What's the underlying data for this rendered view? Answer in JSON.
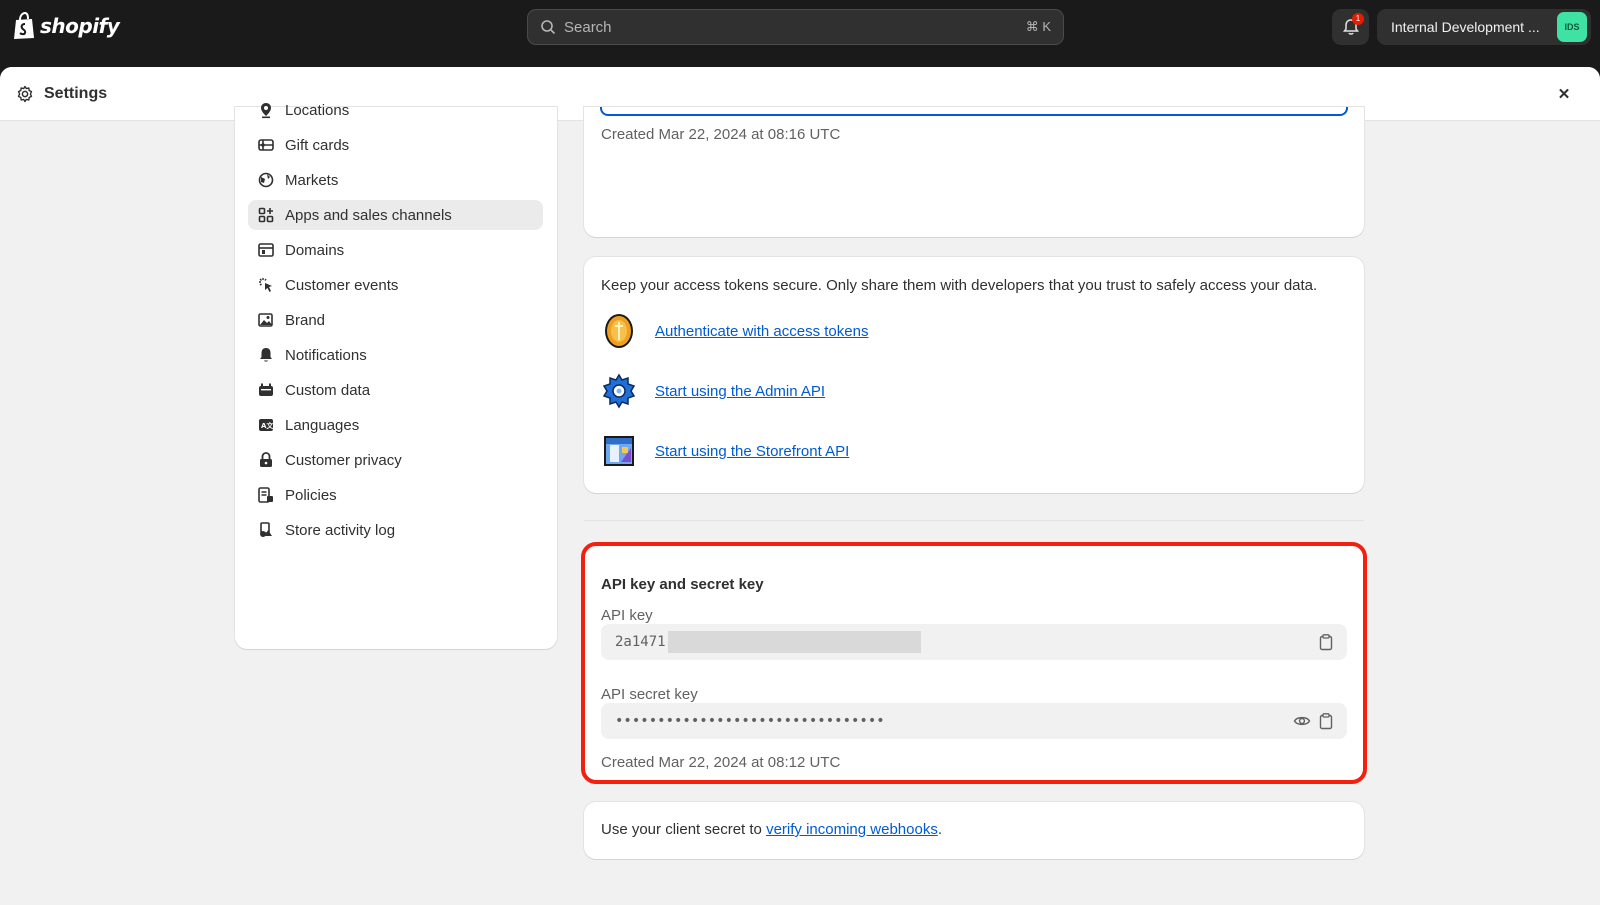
{
  "topbar": {
    "logo_text": "shopify",
    "search_placeholder": "Search",
    "search_shortcut": "⌘ K",
    "notification_count": "1",
    "store_name": "Internal Development ...",
    "avatar_initials": "IDS"
  },
  "modal": {
    "title": "Settings",
    "close_label": "✕"
  },
  "sidebar": {
    "items": [
      {
        "label": "Locations",
        "icon": "location-pin-icon"
      },
      {
        "label": "Gift cards",
        "icon": "gift-card-icon"
      },
      {
        "label": "Markets",
        "icon": "globe-icon"
      },
      {
        "label": "Apps and sales channels",
        "icon": "apps-icon",
        "active": true
      },
      {
        "label": "Domains",
        "icon": "domain-icon"
      },
      {
        "label": "Customer events",
        "icon": "cursor-click-icon"
      },
      {
        "label": "Brand",
        "icon": "brand-image-icon"
      },
      {
        "label": "Notifications",
        "icon": "bell-icon"
      },
      {
        "label": "Custom data",
        "icon": "custom-data-icon"
      },
      {
        "label": "Languages",
        "icon": "language-icon"
      },
      {
        "label": "Customer privacy",
        "icon": "lock-icon"
      },
      {
        "label": "Policies",
        "icon": "policy-list-icon"
      },
      {
        "label": "Store activity log",
        "icon": "activity-log-icon"
      }
    ]
  },
  "content": {
    "token_created": "Created Mar 22, 2024 at 08:16 UTC",
    "tokens_intro": "Keep your access tokens secure. Only share them with developers that you trust to safely access your data.",
    "links": [
      {
        "label": "Authenticate with access tokens",
        "icon": "coin-icon"
      },
      {
        "label": "Start using the Admin API",
        "icon": "gear-pixel-icon"
      },
      {
        "label": "Start using the Storefront API",
        "icon": "storefront-pixel-icon"
      }
    ],
    "api_section": {
      "heading": "API key and secret key",
      "api_key_label": "API key",
      "api_key_value": "2a1471",
      "secret_label": "API secret key",
      "secret_value": "••••••••••••••••••••••••••••••••",
      "created": "Created Mar 22, 2024 at 08:12 UTC",
      "highlight_color": "#f2200c"
    },
    "webhook": {
      "prefix": "Use your client secret to ",
      "link": "verify incoming webhooks",
      "suffix": "."
    }
  },
  "colors": {
    "link": "#005bd3",
    "topbar_bg": "#1a1a1a",
    "page_bg": "#f1f1f1"
  }
}
